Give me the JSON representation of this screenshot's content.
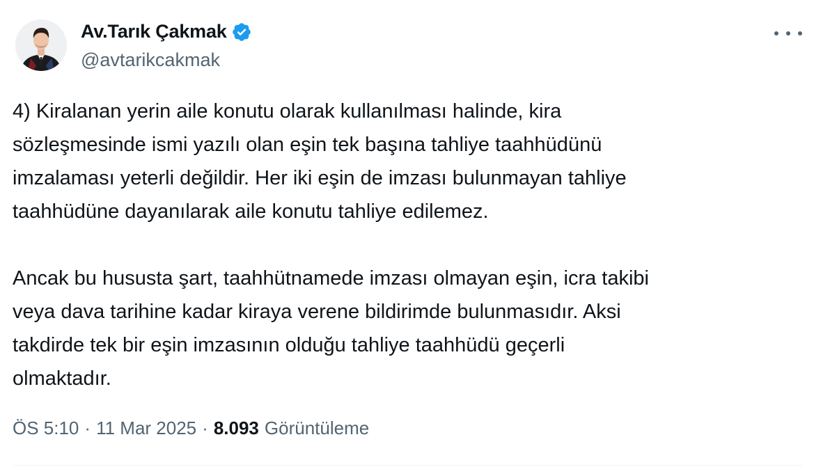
{
  "author": {
    "display_name": "Av.Tarık Çakmak",
    "handle": "@avtarikcakmak",
    "verified": true,
    "verified_color": "#1d9bf0"
  },
  "tweet": {
    "paragraphs": [
      "4) Kiralanan yerin aile konutu olarak kullanılması halinde, kira\nsözleşmesinde ismi yazılı olan eşin tek başına tahliye taahhüdünü\nimzalaması yeterli değildir. Her iki eşin de imzası bulunmayan tahliye\ntaahhüdüne dayanılarak aile konutu tahliye edilemez.",
      "Ancak bu hususta şart, taahhütnamede imzası olmayan eşin, icra takibi\nveya dava tarihine kadar kiraya verene bildirimde bulunmasıdır. Aksi\ntakdirde tek bir eşin imzasının olduğu tahliye taahhüdü geçerli\nolmaktadır."
    ]
  },
  "meta": {
    "time": "ÖS 5:10",
    "separator": "·",
    "date": "11 Mar 2025",
    "views_count": "8.093",
    "views_label": "Görüntüleme"
  },
  "icons": {
    "more": "more-horizontal-icon",
    "verified": "verified-badge-icon"
  }
}
